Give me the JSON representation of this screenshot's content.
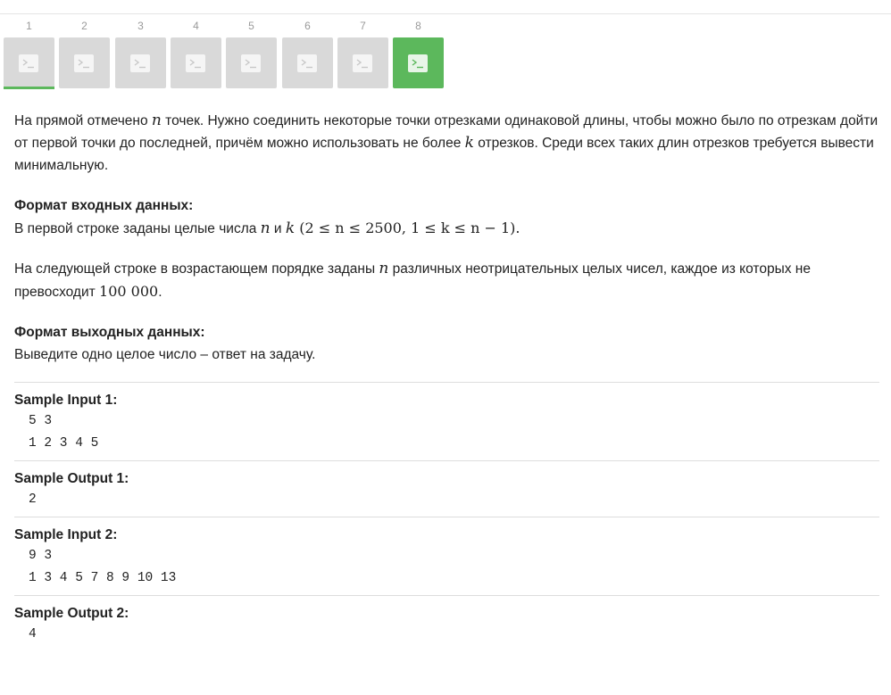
{
  "steps": [
    {
      "number": "1",
      "state": "current"
    },
    {
      "number": "2",
      "state": "default"
    },
    {
      "number": "3",
      "state": "default"
    },
    {
      "number": "4",
      "state": "default"
    },
    {
      "number": "5",
      "state": "default"
    },
    {
      "number": "6",
      "state": "default"
    },
    {
      "number": "7",
      "state": "default"
    },
    {
      "number": "8",
      "state": "passed"
    }
  ],
  "step_icon": "terminal-icon",
  "colors": {
    "passed": "#5cb85c",
    "default_tile": "#d9d9d9",
    "text": "#222222"
  },
  "statement": {
    "p1_a": "На прямой отмечено ",
    "p1_n": "n",
    "p1_b": " точек. Нужно соединить некоторые точки отрезками одинаковой длины, чтобы можно было по отрезкам дойти от первой точки до последней, причём можно использовать не более ",
    "p1_k": "k",
    "p1_c": " отрезков. Среди всех таких длин отрезков требуется вывести минимальную."
  },
  "input_format": {
    "heading": "Формат входных данных:",
    "line_a": "В первой строке заданы целые числа ",
    "n": "n",
    "and": " и ",
    "k": "k",
    "constraints": " (2 ≤ n ≤ 2500, 1 ≤ k ≤ n − 1).",
    "p2_a": "На следующей строке в возрастающем порядке заданы ",
    "p2_n": "n",
    "p2_b": " различных неотрицательных целых чисел, каждое из которых не превосходит ",
    "p2_max": "100 000",
    "p2_c": "."
  },
  "output_format": {
    "heading": "Формат выходных данных:",
    "text": "Выведите одно целое число – ответ на задачу."
  },
  "samples": {
    "input1_title": "Sample Input 1:",
    "input1": "5 3\n1 2 3 4 5",
    "output1_title": "Sample Output 1:",
    "output1": "2",
    "input2_title": "Sample Input 2:",
    "input2": "9 3\n1 3 4 5 7 8 9 10 13",
    "output2_title": "Sample Output 2:",
    "output2": "4"
  }
}
